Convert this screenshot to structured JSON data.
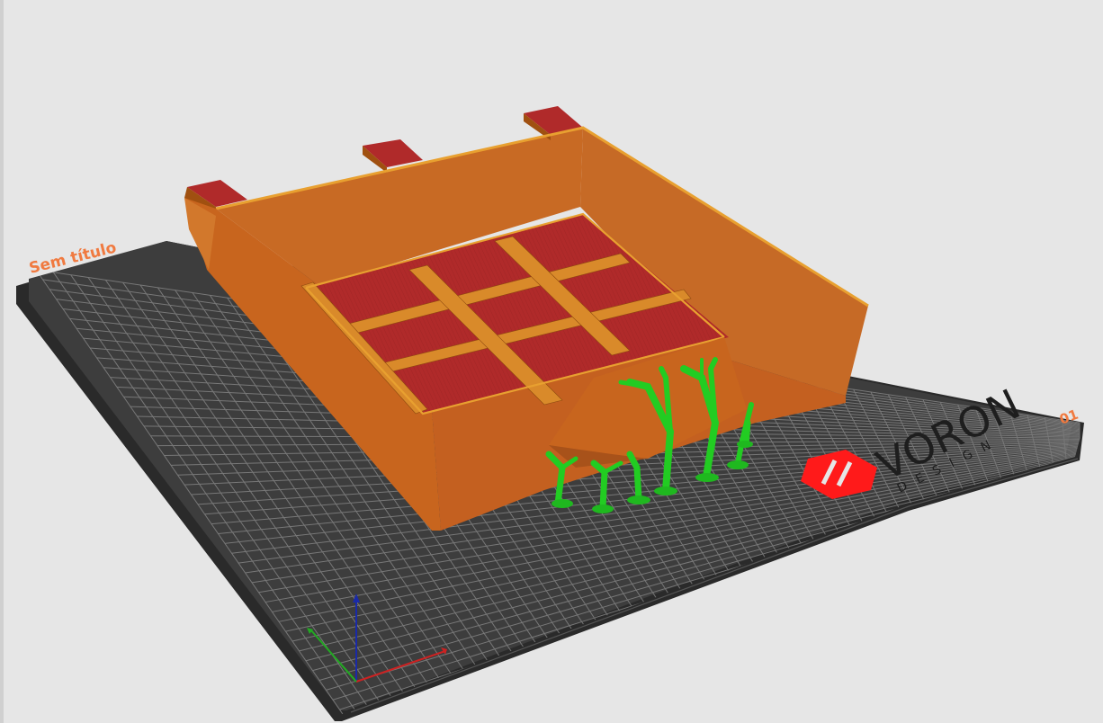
{
  "scene": {
    "bed_label": "Sem título",
    "bed_label_right": "01",
    "logo": {
      "word": "VORON",
      "subword": "DESIGN",
      "mark_color": "#ff1a1a"
    }
  },
  "colors": {
    "background": "#e6e6e6",
    "bed": "#3a3a3a",
    "bed_edge": "#2a2a2a",
    "grid_line": "#8a8a8a",
    "wall": "#c8651e",
    "wall_light": "#d87a2c",
    "wall_dark": "#a8521a",
    "top_surface": "#b02a2a",
    "support": "#22cc22",
    "label_orange": "#f07a40"
  },
  "axes": {
    "x_color": "#cc2222",
    "y_color": "#22aa22",
    "z_color": "#1a2aa8"
  }
}
